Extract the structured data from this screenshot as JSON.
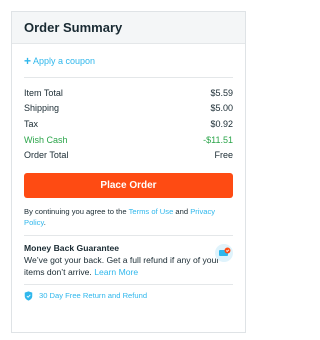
{
  "summary": {
    "title": "Order Summary",
    "coupon_label": "Apply a coupon",
    "lines": [
      {
        "label": "Item Total",
        "value": "$5.59"
      },
      {
        "label": "Shipping",
        "value": "$5.00"
      },
      {
        "label": "Tax",
        "value": "$0.92"
      },
      {
        "label": "Wish Cash",
        "value": "-$11.51"
      },
      {
        "label": "Order Total",
        "value": "Free"
      }
    ],
    "place_order_label": "Place Order",
    "terms": {
      "prefix": "By continuing you agree to the ",
      "terms_link": "Terms of Use",
      "middle": " and",
      "privacy_link": "Privacy Policy",
      "suffix": "."
    },
    "guarantee": {
      "title": "Money Back Guarantee",
      "text": "We’ve got your back. Get a full refund if any of your items don’t arrive. ",
      "link": "Learn More"
    },
    "return_label": "30 Day Free Return and Refund"
  },
  "colors": {
    "accent": "#2fb7ec",
    "button": "#fe4b13",
    "credit": "#2ba54a",
    "text": "#192a32"
  }
}
